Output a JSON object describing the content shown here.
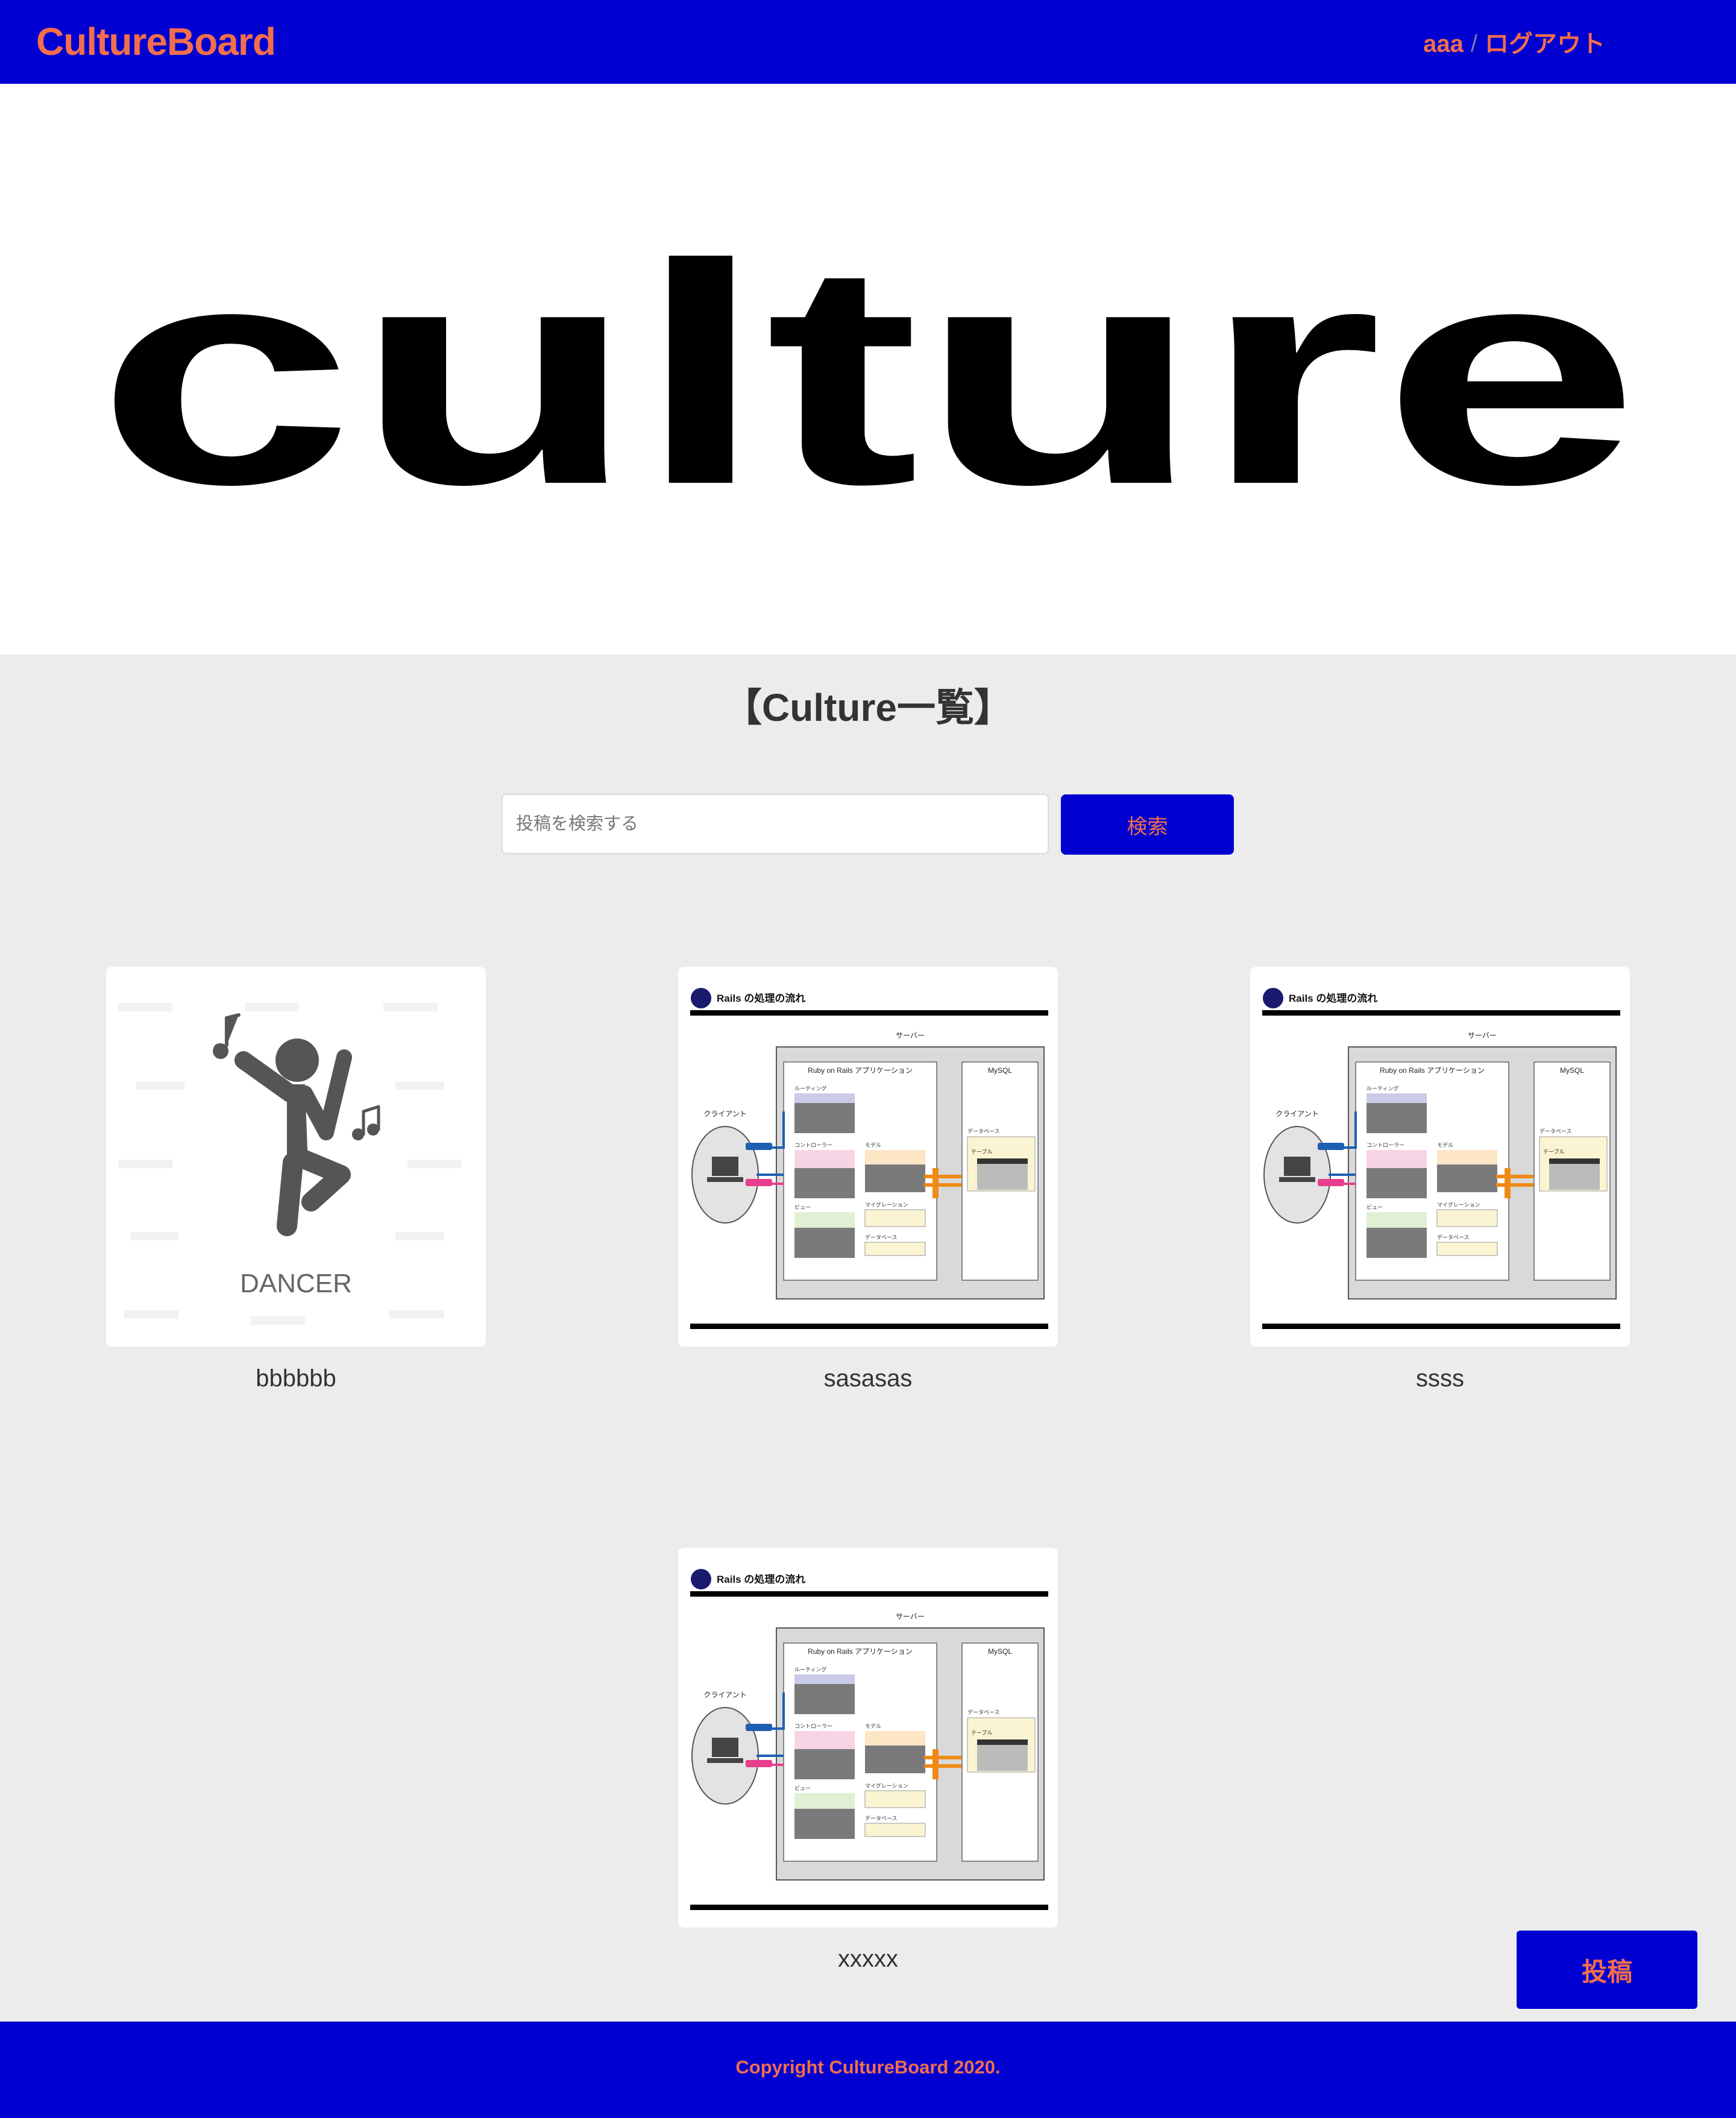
{
  "header": {
    "brand": "CultureBoard",
    "user": "aaa",
    "separator": "/",
    "logout": "ログアウト"
  },
  "hero": {
    "text": "culture"
  },
  "list": {
    "title": "【Culture一覧】"
  },
  "search": {
    "placeholder": "投稿を検索する",
    "button": "検索"
  },
  "posts": [
    {
      "title": "bbbbbb",
      "image": "dancer",
      "image_caption": "DANCER"
    },
    {
      "title": "sasasas",
      "image": "rails-diagram"
    },
    {
      "title": "ssss",
      "image": "rails-diagram"
    },
    {
      "title": "xxxxx",
      "image": "rails-diagram"
    }
  ],
  "diagram": {
    "title": "Rails の処理の流れ",
    "server": "サーバー",
    "app": "Ruby on Rails アプリケーション",
    "db": "MySQL",
    "client": "クライアント",
    "routing": "ルーティング",
    "controller": "コントローラー",
    "model": "モデル",
    "view": "ビュー",
    "migration": "マイグレーション",
    "database": "データベース",
    "table": "テーブル"
  },
  "post_button": "投稿",
  "footer": {
    "copyright": "Copyright CultureBoard 2020."
  },
  "colors": {
    "brand_blue": "#0000d0",
    "accent_orange": "#f26e4c",
    "background": "#ececec"
  }
}
